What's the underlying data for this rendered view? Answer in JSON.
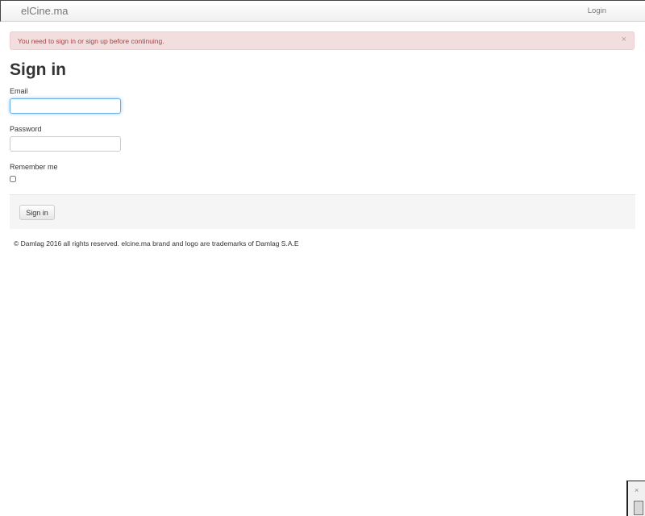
{
  "navbar": {
    "brand": "elCine.ma",
    "login_label": "Login"
  },
  "alert": {
    "message": "You need to sign in or sign up before continuing.",
    "close_glyph": "×"
  },
  "form": {
    "title": "Sign in",
    "email_label": "Email",
    "email_value": "",
    "password_label": "Password",
    "password_value": "",
    "remember_label": "Remember me",
    "remember_checked": false,
    "submit_label": "Sign in"
  },
  "footer": {
    "text": "© Damlag 2016 all rights reserved. elcine.ma brand and logo are trademarks of Damlag S.A.E"
  },
  "corner_widget": {
    "close_glyph": "×"
  },
  "colors": {
    "alert_background": "#f2dede",
    "alert_text": "#a94442",
    "focus_border": "#66afe9",
    "nav_text": "#777777"
  }
}
